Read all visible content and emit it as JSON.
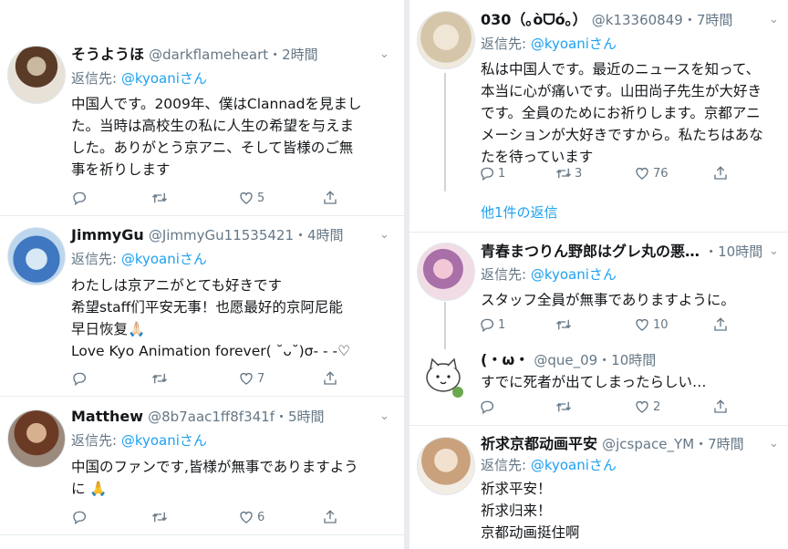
{
  "left_column": [
    {
      "name": "そうようほ",
      "handle": "@darkflameheart",
      "time": "・2時間",
      "reply_prefix": "返信先: ",
      "reply_to": "@kyoaniさん",
      "text": "中国人です。2009年、僕はClannadを見まし\nた。当時は高校生の私に人生の希望を与えま\nした。ありがとう京アニ、そして皆様のご無\n事を祈りします",
      "reply_count": "",
      "retweet_count": "",
      "like_count": "5"
    },
    {
      "name": "JimmyGu",
      "handle": "@JimmyGu11535421",
      "time": "・4時間",
      "reply_prefix": "返信先: ",
      "reply_to": "@kyoaniさん",
      "text": "わたしは京アニがとても好きです\n希望staff们平安无事！也愿最好的京阿尼能\n早日恢复🙏🏻\nLove Kyo Animation forever( ˘ᴗ˘)σ- - -♡",
      "reply_count": "",
      "retweet_count": "",
      "like_count": "7"
    },
    {
      "name": "Matthew",
      "handle": "@8b7aac1ff8f341f",
      "time": "・5時間",
      "reply_prefix": "返信先: ",
      "reply_to": "@kyoaniさん",
      "text": "中国のファンです,皆様が無事でありますよう\nに 🙏",
      "reply_count": "",
      "retweet_count": "",
      "like_count": "6"
    }
  ],
  "right_column": [
    {
      "name": "030（｡òᗜó｡）",
      "handle": "@k13360849",
      "time": "・7時間",
      "reply_prefix": "返信先: ",
      "reply_to": "@kyoaniさん",
      "text": "私は中国人です。最近のニュースを知って、\n本当に心が痛いです。山田尚子先生が大好き\nです。全員のためにお祈りします。京都アニ\nメーションが大好きですから。私たちはあな\nたを待っています",
      "reply_count": "1",
      "retweet_count": "3",
      "like_count": "76",
      "more_replies": "他1件の返信"
    },
    {
      "name": "青春まつりん野郎はグレ丸の悪…",
      "handle": "",
      "time": "・10時間",
      "reply_prefix": "返信先: ",
      "reply_to": "@kyoaniさん",
      "text": "スタッフ全員が無事でありますように。",
      "reply_count": "1",
      "retweet_count": "",
      "like_count": "10"
    },
    {
      "name": "(・ω・",
      "handle": "@que_09",
      "time": "・10時間",
      "text": "すでに死者が出てしまったらしい…",
      "reply_count": "",
      "retweet_count": "",
      "like_count": "2"
    },
    {
      "name": "祈求京都动画平安",
      "handle": "@jcspace_YM",
      "time": "・7時間",
      "reply_prefix": "返信先: ",
      "reply_to": "@kyoaniさん",
      "text": "祈求平安！\n祈求归来！\n京都动画挺住啊"
    }
  ],
  "icons": {
    "reply": "reply-icon",
    "retweet": "retweet-icon",
    "like": "heart-icon",
    "share": "share-icon",
    "menu": "chevron-down-icon"
  },
  "colors": {
    "link": "#1da1f2",
    "secondary_text": "#657786",
    "divider": "#e6ecf0"
  }
}
